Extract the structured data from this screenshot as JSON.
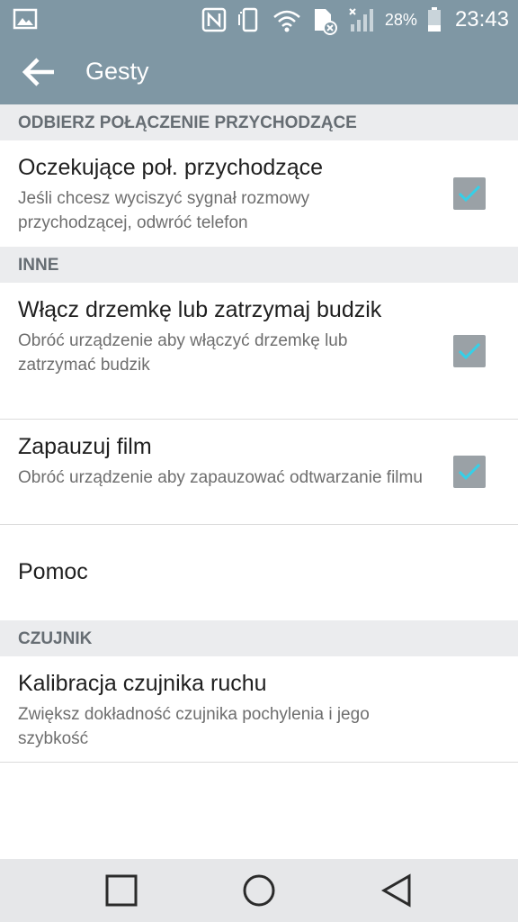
{
  "status_bar": {
    "battery_percent": "28%",
    "time": "23:43",
    "icons": [
      "gallery-icon",
      "nfc-icon",
      "vibrate-icon",
      "wifi-icon",
      "sim-error-icon",
      "signal-icon",
      "battery-icon"
    ]
  },
  "app_bar": {
    "title": "Gesty"
  },
  "sections": {
    "incoming": {
      "header": "ODBIERZ POŁĄCZENIE PRZYCHODZĄCE",
      "items": [
        {
          "title": "Oczekujące poł. przychodzące",
          "summary": "Jeśli chcesz wyciszyć sygnał rozmowy przychodzącej, odwróć telefon",
          "checked": true
        }
      ]
    },
    "other": {
      "header": "INNE",
      "items": [
        {
          "title": "Włącz drzemkę lub zatrzymaj budzik",
          "summary": "Obróć urządzenie aby włączyć drzemkę lub zatrzymać budzik",
          "checked": true
        },
        {
          "title": "Zapauzuj film",
          "summary": "Obróć urządzenie aby zapauzować odtwarzanie filmu",
          "checked": true
        },
        {
          "title": "Pomoc"
        }
      ]
    },
    "sensor": {
      "header": "CZUJNIK",
      "items": [
        {
          "title": "Kalibracja czujnika ruchu",
          "summary": "Zwiększ dokładność czujnika pochylenia i jego szybkość"
        }
      ]
    }
  },
  "nav_bar": {
    "buttons": [
      "recent-apps-icon",
      "home-icon",
      "back-icon"
    ]
  },
  "colors": {
    "app_bar": "#7f97a4",
    "section_header_bg": "#ebecee",
    "checkbox_bg": "#9aa1a6",
    "checkmark": "#35d0e8",
    "nav_bar": "#e6e7e9"
  }
}
